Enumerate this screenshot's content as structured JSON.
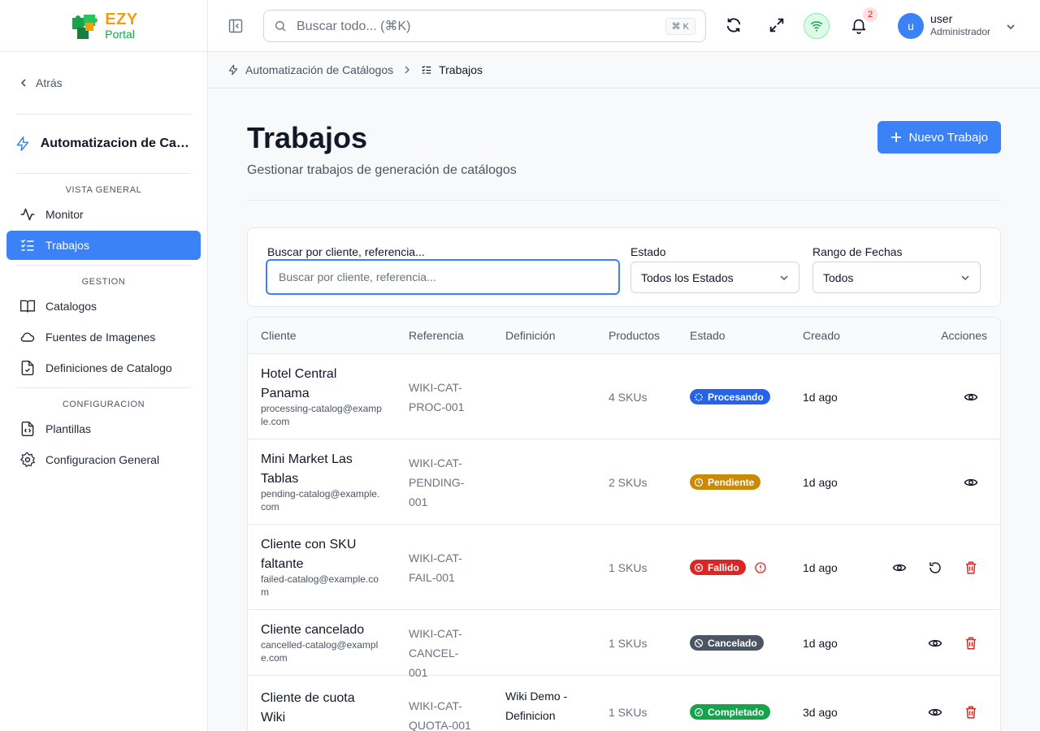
{
  "brand": {
    "ezy": "EZY",
    "portal": "Portal"
  },
  "topbar": {
    "search_placeholder": "Buscar todo... (⌘K)",
    "search_kbd": "⌘ K",
    "notifications_count": "2",
    "user_initial": "u",
    "user_name": "user",
    "user_role": "Administrador"
  },
  "sidebar": {
    "back_label": "Atrás",
    "module_title": "Automatizacion de Catalogos",
    "sections": [
      {
        "label": "VISTA GENERAL",
        "items": [
          {
            "label": "Monitor",
            "icon": "activity-icon"
          },
          {
            "label": "Trabajos",
            "icon": "list-checks-icon",
            "active": true
          }
        ]
      },
      {
        "label": "GESTION",
        "items": [
          {
            "label": "Catalogos",
            "icon": "book-icon"
          },
          {
            "label": "Fuentes de Imagenes",
            "icon": "cloud-icon"
          },
          {
            "label": "Definiciones de Catalogo",
            "icon": "file-check-icon"
          }
        ]
      },
      {
        "label": "CONFIGURACION",
        "items": [
          {
            "label": "Plantillas",
            "icon": "file-code-icon"
          },
          {
            "label": "Configuracion General",
            "icon": "gear-icon"
          }
        ]
      }
    ]
  },
  "breadcrumb": {
    "parent": "Automatización de Catálogos",
    "current": "Trabajos"
  },
  "page": {
    "title": "Trabajos",
    "subtitle": "Gestionar trabajos de generación de catálogos",
    "new_button": "Nuevo Trabajo"
  },
  "filters": {
    "search_label": "Buscar por cliente, referencia...",
    "search_placeholder": "Buscar por cliente, referencia...",
    "status_label": "Estado",
    "status_value": "Todos los Estados",
    "date_label": "Rango de Fechas",
    "date_value": "Todos"
  },
  "table": {
    "columns": [
      "Cliente",
      "Referencia",
      "Definición",
      "Productos",
      "Estado",
      "Creado",
      "Acciones"
    ],
    "rows": [
      {
        "client": "Hotel Central Panama",
        "email": "processing-catalog@example.com",
        "ref": "WIKI-CAT-PROC-001",
        "definition": "",
        "products": "4 SKUs",
        "status": "Procesando",
        "status_color": "#2563eb",
        "created": "1d ago"
      },
      {
        "client": "Mini Market Las Tablas",
        "email": "pending-catalog@example.com",
        "ref": "WIKI-CAT-PENDING-001",
        "definition": "",
        "products": "2 SKUs",
        "status": "Pendiente",
        "status_color": "#ca8a04",
        "created": "1d ago"
      },
      {
        "client": "Cliente con SKU faltante",
        "email": "failed-catalog@example.com",
        "ref": "WIKI-CAT-FAIL-001",
        "definition": "",
        "products": "1 SKUs",
        "status": "Fallido",
        "status_color": "#dc2626",
        "created": "1d ago"
      },
      {
        "client": "Cliente cancelado",
        "email": "cancelled-catalog@example.com",
        "ref": "WIKI-CAT-CANCEL-001",
        "definition": "",
        "products": "1 SKUs",
        "status": "Cancelado",
        "status_color": "#4b5563",
        "created": "1d ago"
      },
      {
        "client": "Cliente de cuota Wiki",
        "email": "",
        "ref": "WIKI-CAT-QUOTA-001",
        "definition": "Wiki Demo - Definicion",
        "products": "1 SKUs",
        "status": "Completado",
        "status_color": "#16a34a",
        "created": "3d ago"
      }
    ]
  }
}
